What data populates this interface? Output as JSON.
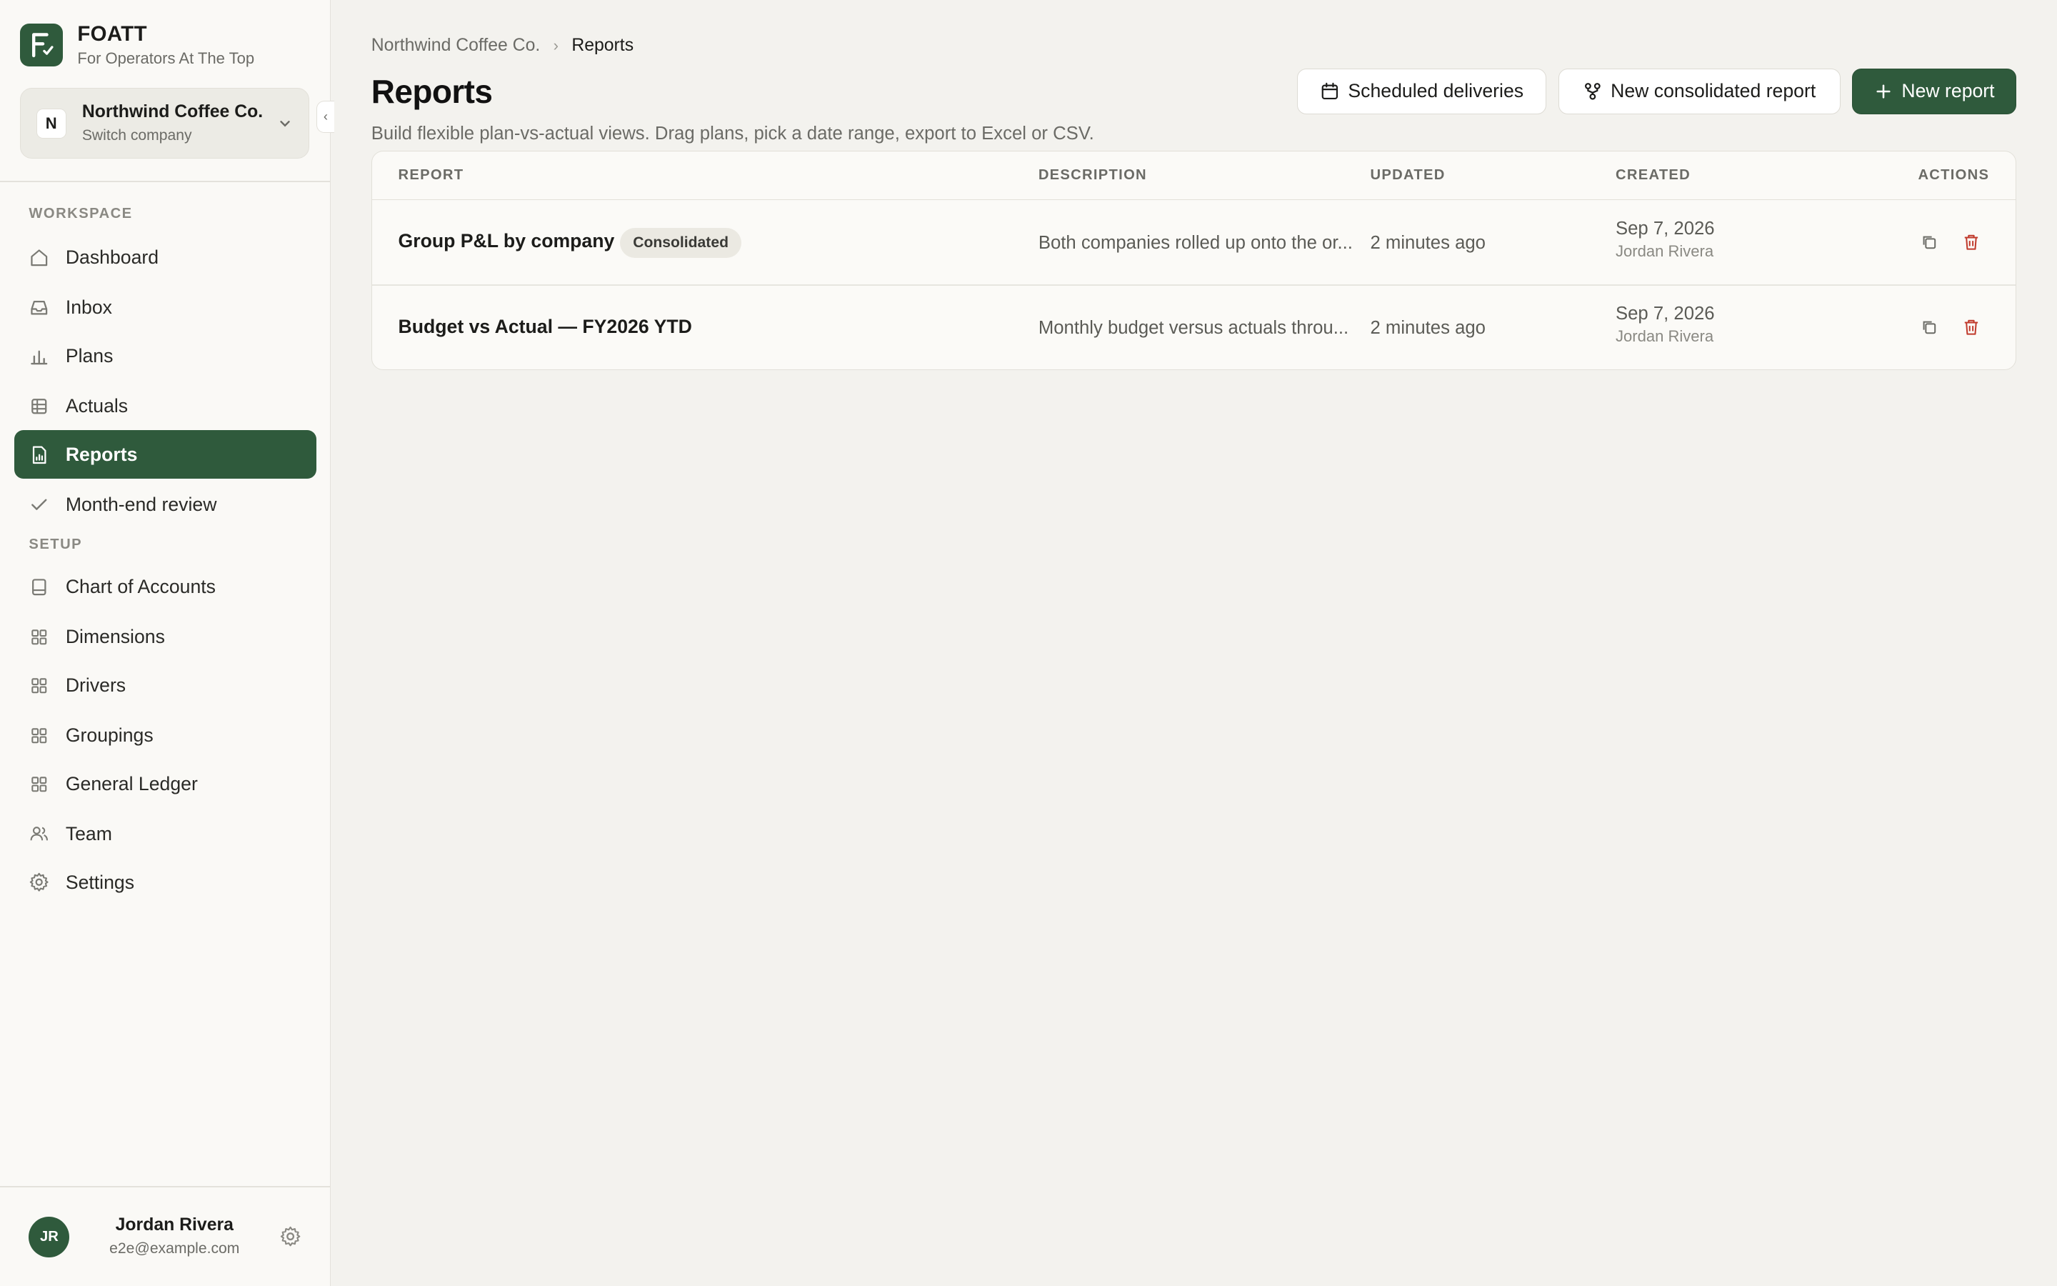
{
  "brand": {
    "name": "FOATT",
    "tagline": "For Operators At The Top",
    "logo_letter": "F"
  },
  "company": {
    "initial": "N",
    "name": "Northwind Coffee Co.",
    "switch_label": "Switch company"
  },
  "sidebar": {
    "workspace_label": "WORKSPACE",
    "setup_label": "SETUP",
    "workspace_items": [
      {
        "label": "Dashboard",
        "icon": "home-icon"
      },
      {
        "label": "Inbox",
        "icon": "inbox-icon"
      },
      {
        "label": "Plans",
        "icon": "bar-chart-icon"
      },
      {
        "label": "Actuals",
        "icon": "table-icon"
      },
      {
        "label": "Reports",
        "icon": "report-icon",
        "active": true
      },
      {
        "label": "Month-end review",
        "icon": "check-icon"
      }
    ],
    "setup_items": [
      {
        "label": "Chart of Accounts",
        "icon": "book-icon"
      },
      {
        "label": "Dimensions",
        "icon": "grid-icon"
      },
      {
        "label": "Drivers",
        "icon": "grid-icon"
      },
      {
        "label": "Groupings",
        "icon": "grid-icon"
      },
      {
        "label": "General Ledger",
        "icon": "grid-icon"
      },
      {
        "label": "Team",
        "icon": "users-icon"
      },
      {
        "label": "Settings",
        "icon": "gear-icon"
      }
    ]
  },
  "user": {
    "initials": "JR",
    "name": "Jordan Rivera",
    "email": "e2e@example.com"
  },
  "breadcrumb": {
    "parent": "Northwind Coffee Co.",
    "current": "Reports"
  },
  "page": {
    "title": "Reports",
    "subtitle": "Build flexible plan-vs-actual views. Drag plans, pick a date range, export to Excel or CSV."
  },
  "toolbar": {
    "scheduled_label": "Scheduled deliveries",
    "consolidated_label": "New consolidated report",
    "new_report_label": "New report"
  },
  "table": {
    "columns": {
      "report": "REPORT",
      "description": "DESCRIPTION",
      "updated": "UPDATED",
      "created": "CREATED",
      "actions": "ACTIONS"
    },
    "rows": [
      {
        "name": "Group P&L by company",
        "badge": "Consolidated",
        "description": "Both companies rolled up onto the or...",
        "updated": "2 minutes ago",
        "created_date": "Sep 7, 2026",
        "created_by": "Jordan Rivera"
      },
      {
        "name": "Budget vs Actual — FY2026 YTD",
        "badge": "",
        "description": "Monthly budget versus actuals throu...",
        "updated": "2 minutes ago",
        "created_date": "Sep 7, 2026",
        "created_by": "Jordan Rivera"
      }
    ]
  },
  "colors": {
    "accent": "#2f5a3c",
    "danger": "#c0392b",
    "background": "#f3f2ee",
    "sidebar": "#faf9f6"
  }
}
